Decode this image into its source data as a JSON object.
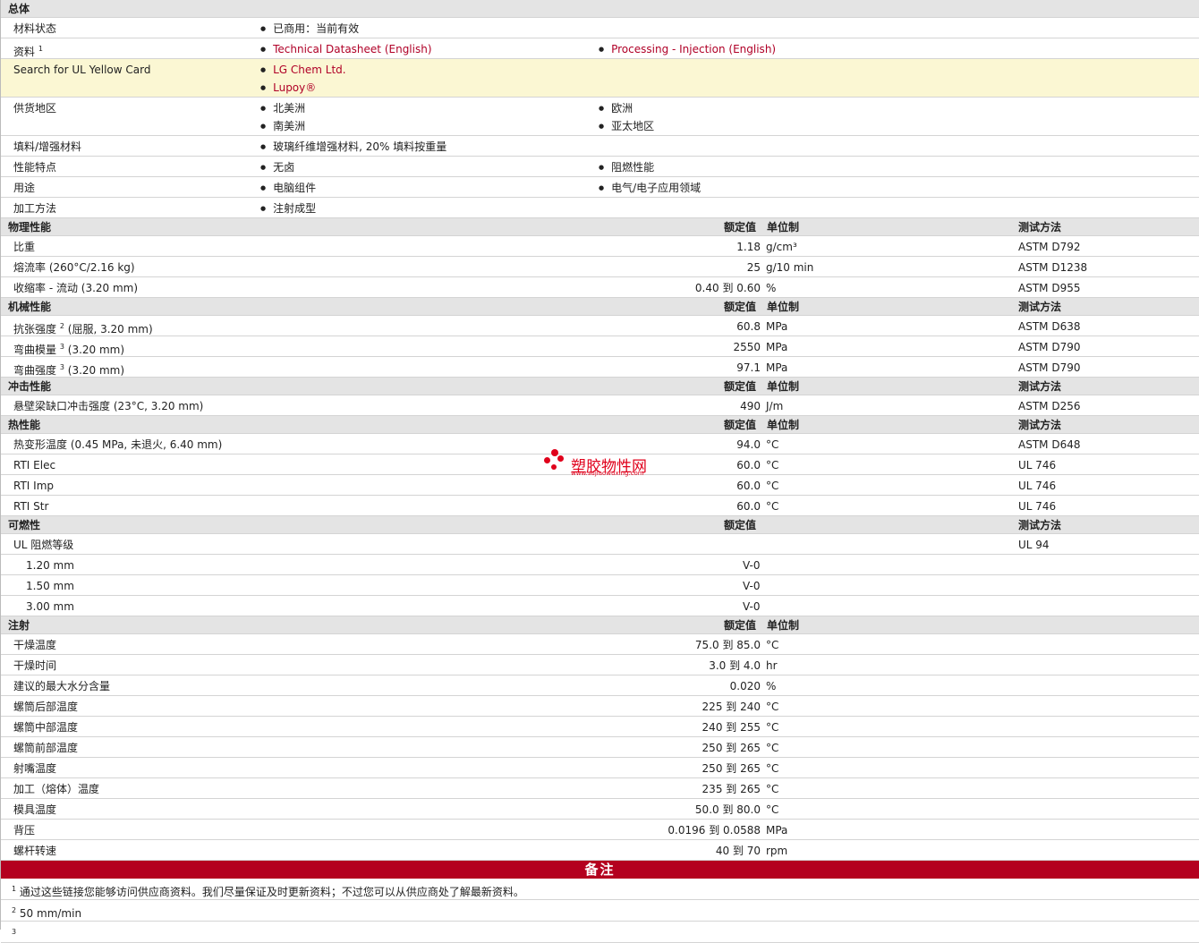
{
  "general": {
    "title": "总体",
    "status_label": "材料状态",
    "status_value": "已商用：当前有效",
    "docs_label": "资料",
    "docs_sup": "1",
    "docs": [
      "Technical Datasheet (English)",
      "Processing - Injection (English)"
    ],
    "ul_label": "Search for UL Yellow Card",
    "ul_links": [
      "LG Chem Ltd.",
      "Lupoy®"
    ],
    "region_label": "供货地区",
    "regions_col1": [
      "北美洲",
      "南美洲"
    ],
    "regions_col2": [
      "欧洲",
      "亚太地区"
    ],
    "filler_label": "填料/增强材料",
    "filler_value": "玻璃纤维增强材料, 20% 填料按重量",
    "features_label": "性能特点",
    "features": [
      "无卤",
      "阻燃性能"
    ],
    "uses_label": "用途",
    "uses": [
      "电脑组件",
      "电气/电子应用领域"
    ],
    "process_label": "加工方法",
    "process_value": "注射成型"
  },
  "headers": {
    "value": "额定值",
    "unit": "单位制",
    "method": "测试方法"
  },
  "physical": {
    "title": "物理性能",
    "rows": [
      {
        "label": "比重",
        "value": "1.18",
        "unit": "g/cm³",
        "method": "ASTM D792"
      },
      {
        "label": "熔流率 (260°C/2.16 kg)",
        "value": "25",
        "unit": "g/10 min",
        "method": "ASTM D1238"
      },
      {
        "label": "收缩率 - 流动 (3.20 mm)",
        "value": "0.40 到 0.60",
        "unit": "%",
        "method": "ASTM D955"
      }
    ]
  },
  "mechanical": {
    "title": "机械性能",
    "rows": [
      {
        "label": "抗张强度",
        "sup": "2",
        "cond": "(屈服, 3.20 mm)",
        "value": "60.8",
        "unit": "MPa",
        "method": "ASTM D638"
      },
      {
        "label": "弯曲模量",
        "sup": "3",
        "cond": "(3.20 mm)",
        "value": "2550",
        "unit": "MPa",
        "method": "ASTM D790"
      },
      {
        "label": "弯曲强度",
        "sup": "3",
        "cond": "(3.20 mm)",
        "value": "97.1",
        "unit": "MPa",
        "method": "ASTM D790"
      }
    ]
  },
  "impact": {
    "title": "冲击性能",
    "rows": [
      {
        "label": "悬壁梁缺口冲击强度 (23°C, 3.20 mm)",
        "value": "490",
        "unit": "J/m",
        "method": "ASTM D256"
      }
    ]
  },
  "thermal": {
    "title": "热性能",
    "rows": [
      {
        "label": "热变形温度 (0.45 MPa, 未退火, 6.40 mm)",
        "value": "94.0",
        "unit": "°C",
        "method": "ASTM D648"
      },
      {
        "label": "RTI Elec",
        "value": "60.0",
        "unit": "°C",
        "method": "UL 746"
      },
      {
        "label": "RTI Imp",
        "value": "60.0",
        "unit": "°C",
        "method": "UL 746"
      },
      {
        "label": "RTI Str",
        "value": "60.0",
        "unit": "°C",
        "method": "UL 746"
      }
    ]
  },
  "flammability": {
    "title": "可燃性",
    "ul_label": "UL 阻燃等级",
    "ul_method": "UL 94",
    "rows": [
      {
        "label": "1.20 mm",
        "value": "V-0"
      },
      {
        "label": "1.50 mm",
        "value": "V-0"
      },
      {
        "label": "3.00 mm",
        "value": "V-0"
      }
    ]
  },
  "injection": {
    "title": "注射",
    "rows": [
      {
        "label": "干燥温度",
        "value": "75.0 到 85.0",
        "unit": "°C"
      },
      {
        "label": "干燥时间",
        "value": "3.0 到 4.0",
        "unit": "hr"
      },
      {
        "label": "建议的最大水分含量",
        "value": "0.020",
        "unit": "%"
      },
      {
        "label": "螺筒后部温度",
        "value": "225 到 240",
        "unit": "°C"
      },
      {
        "label": "螺筒中部温度",
        "value": "240 到 255",
        "unit": "°C"
      },
      {
        "label": "螺筒前部温度",
        "value": "250 到 265",
        "unit": "°C"
      },
      {
        "label": "射嘴温度",
        "value": "250 到 265",
        "unit": "°C"
      },
      {
        "label": "加工（熔体）温度",
        "value": "235 到 265",
        "unit": "°C"
      },
      {
        "label": "模具温度",
        "value": "50.0 到 80.0",
        "unit": "°C"
      },
      {
        "label": "背压",
        "value": "0.0196 到 0.0588",
        "unit": "MPa"
      },
      {
        "label": "螺杆转速",
        "value": "40 到 70",
        "unit": "rpm"
      }
    ]
  },
  "notes": {
    "title": "备注",
    "items": [
      {
        "num": "1",
        "text": "通过这些链接您能够访问供应商资料。我们尽量保证及时更新资料；不过您可以从供应商处了解最新资料。"
      },
      {
        "num": "2",
        "text": "50 mm/min"
      },
      {
        "num": "3",
        "text": ""
      }
    ]
  },
  "watermark": {
    "title": "塑胶物性网",
    "url": "www.sujiaowuxing.com"
  }
}
